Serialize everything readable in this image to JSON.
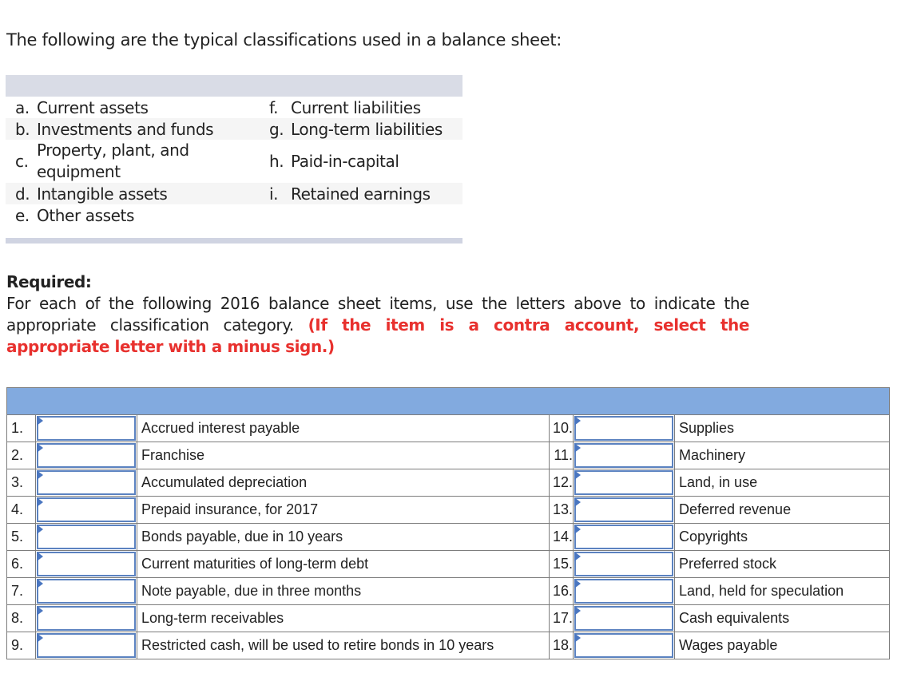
{
  "intro": "The following are the typical classifications used in a balance sheet:",
  "classifications": [
    {
      "left_letter": "a.",
      "left_label": "Current assets",
      "right_letter": "f.",
      "right_label": "Current liabilities"
    },
    {
      "left_letter": "b.",
      "left_label": "Investments and funds",
      "right_letter": "g.",
      "right_label": "Long-term liabilities"
    },
    {
      "left_letter": "c.",
      "left_label": "Property, plant, and equipment",
      "right_letter": "h.",
      "right_label": "Paid-in-capital"
    },
    {
      "left_letter": "d.",
      "left_label": "Intangible assets",
      "right_letter": "i.",
      "right_label": "Retained earnings"
    },
    {
      "left_letter": "e.",
      "left_label": "Other assets",
      "right_letter": "",
      "right_label": ""
    }
  ],
  "required": {
    "heading": "Required:",
    "instruction": "For each of the following 2016 balance sheet items, use the letters above to indicate the appropriate classification category.",
    "note": "(If the item is a contra account, select the appropriate letter with a minus sign.)"
  },
  "items_left": [
    {
      "num": "1.",
      "value": "",
      "desc": "Accrued interest payable"
    },
    {
      "num": "2.",
      "value": "",
      "desc": "Franchise"
    },
    {
      "num": "3.",
      "value": "",
      "desc": "Accumulated depreciation"
    },
    {
      "num": "4.",
      "value": "",
      "desc": "Prepaid insurance, for 2017"
    },
    {
      "num": "5.",
      "value": "",
      "desc": "Bonds payable, due in 10 years"
    },
    {
      "num": "6.",
      "value": "",
      "desc": "Current maturities of long-term debt"
    },
    {
      "num": "7.",
      "value": "",
      "desc": "Note payable, due in three months"
    },
    {
      "num": "8.",
      "value": "",
      "desc": "Long-term receivables"
    },
    {
      "num": "9.",
      "value": "",
      "desc": "Restricted cash, will be used to retire bonds in 10 years"
    }
  ],
  "items_right": [
    {
      "num": "10.",
      "value": "",
      "desc": "Supplies"
    },
    {
      "num": "11.",
      "value": "",
      "desc": "Machinery"
    },
    {
      "num": "12.",
      "value": "",
      "desc": "Land, in use"
    },
    {
      "num": "13.",
      "value": "",
      "desc": "Deferred revenue"
    },
    {
      "num": "14.",
      "value": "",
      "desc": "Copyrights"
    },
    {
      "num": "15.",
      "value": "",
      "desc": "Preferred stock"
    },
    {
      "num": "16.",
      "value": "",
      "desc": "Land, held for speculation"
    },
    {
      "num": "17.",
      "value": "",
      "desc": "Cash equivalents"
    },
    {
      "num": "18.",
      "value": "",
      "desc": "Wages payable"
    }
  ]
}
